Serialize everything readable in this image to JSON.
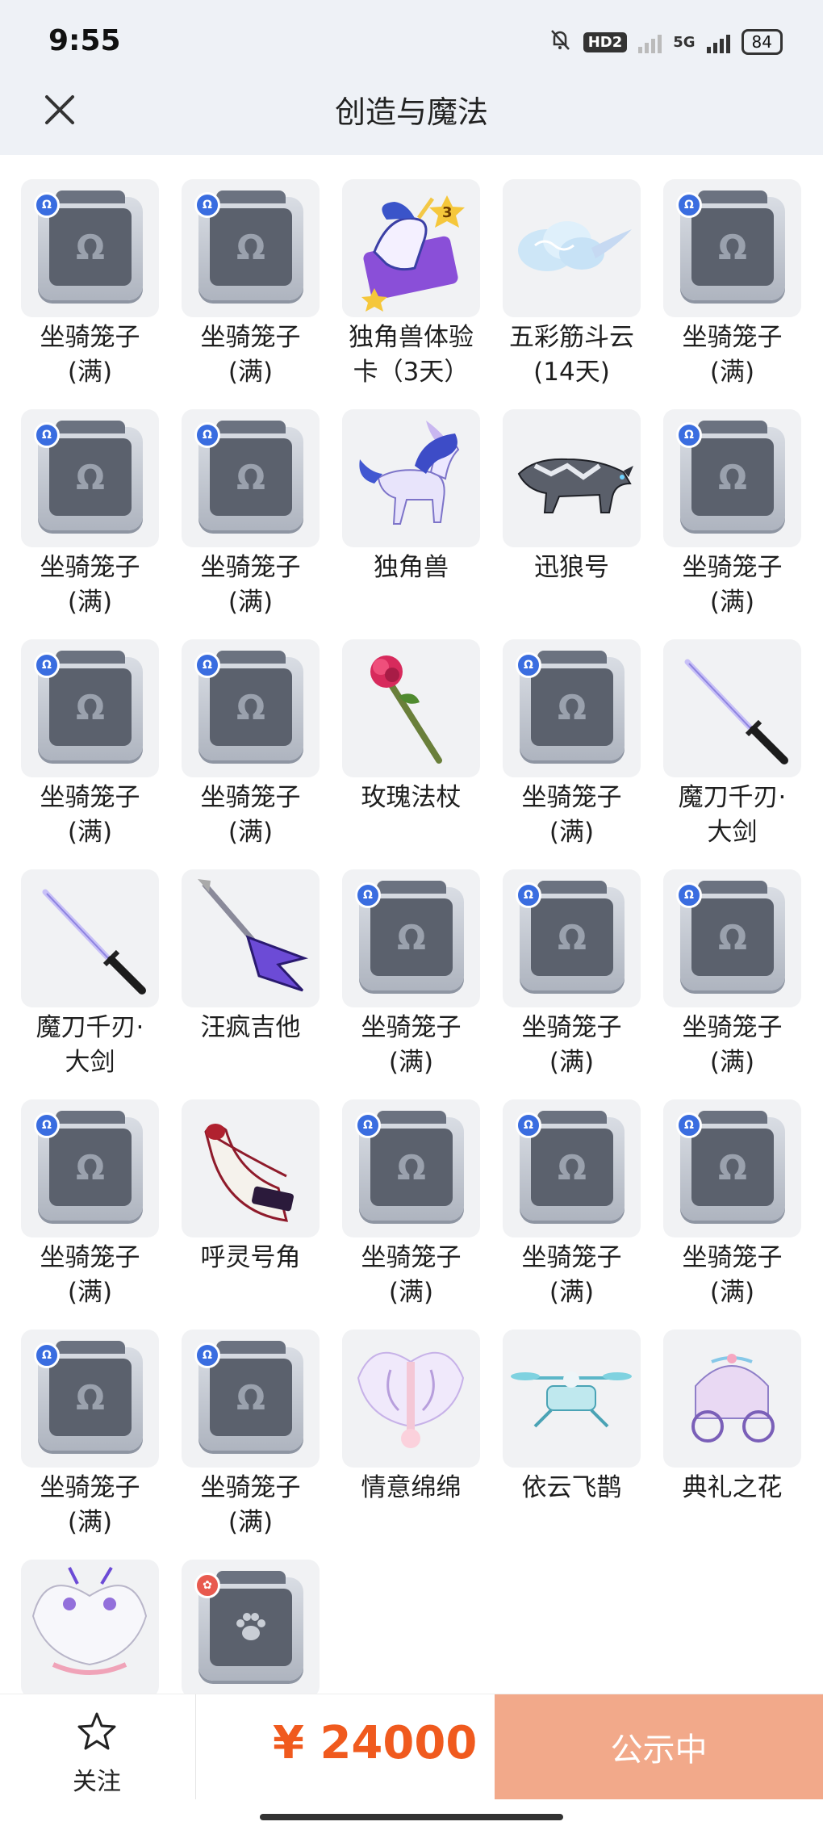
{
  "status_bar": {
    "time": "9:55",
    "network_badge": "HD2",
    "network_type": "5G",
    "battery": "84"
  },
  "nav": {
    "title": "创造与魔法"
  },
  "items": [
    {
      "label": "坐骑笼子\n(满)",
      "icon": "cage"
    },
    {
      "label": "坐骑笼子\n(满)",
      "icon": "cage"
    },
    {
      "label": "独角兽体验\n卡（3天）",
      "icon": "unicorn-card",
      "card_level": "3"
    },
    {
      "label": "五彩筋斗云\n(14天)",
      "icon": "cloud"
    },
    {
      "label": "坐骑笼子\n(满)",
      "icon": "cage"
    },
    {
      "label": "坐骑笼子\n(满)",
      "icon": "cage"
    },
    {
      "label": "坐骑笼子\n(满)",
      "icon": "cage"
    },
    {
      "label": "独角兽",
      "icon": "unicorn"
    },
    {
      "label": "迅狼号",
      "icon": "wolf"
    },
    {
      "label": "坐骑笼子\n(满)",
      "icon": "cage"
    },
    {
      "label": "坐骑笼子\n(满)",
      "icon": "cage"
    },
    {
      "label": "坐骑笼子\n(满)",
      "icon": "cage"
    },
    {
      "label": "玫瑰法杖",
      "icon": "rose-staff"
    },
    {
      "label": "坐骑笼子\n(满)",
      "icon": "cage"
    },
    {
      "label": "魔刀千刃·\n大剑",
      "icon": "sword"
    },
    {
      "label": "魔刀千刃·\n大剑",
      "icon": "sword"
    },
    {
      "label": "汪疯吉他",
      "icon": "guitar"
    },
    {
      "label": "坐骑笼子\n(满)",
      "icon": "cage"
    },
    {
      "label": "坐骑笼子\n(满)",
      "icon": "cage"
    },
    {
      "label": "坐骑笼子\n(满)",
      "icon": "cage"
    },
    {
      "label": "坐骑笼子\n(满)",
      "icon": "cage"
    },
    {
      "label": "呼灵号角",
      "icon": "horn"
    },
    {
      "label": "坐骑笼子\n(满)",
      "icon": "cage"
    },
    {
      "label": "坐骑笼子\n(满)",
      "icon": "cage"
    },
    {
      "label": "坐骑笼子\n(满)",
      "icon": "cage"
    },
    {
      "label": "坐骑笼子\n(满)",
      "icon": "cage"
    },
    {
      "label": "坐骑笼子\n(满)",
      "icon": "cage"
    },
    {
      "label": "情意绵绵",
      "icon": "wings"
    },
    {
      "label": "依云飞鹊",
      "icon": "drone"
    },
    {
      "label": "典礼之花",
      "icon": "carriage"
    },
    {
      "label": "",
      "icon": "wings-white"
    },
    {
      "label": "",
      "icon": "pet-cage"
    }
  ],
  "bottom_bar": {
    "follow_label": "关注",
    "price": "¥ 24000",
    "action_label": "公示中"
  },
  "colors": {
    "accent": "#f05a1e",
    "action_bg": "#f2a98a",
    "header_bg": "#eef1f6"
  }
}
